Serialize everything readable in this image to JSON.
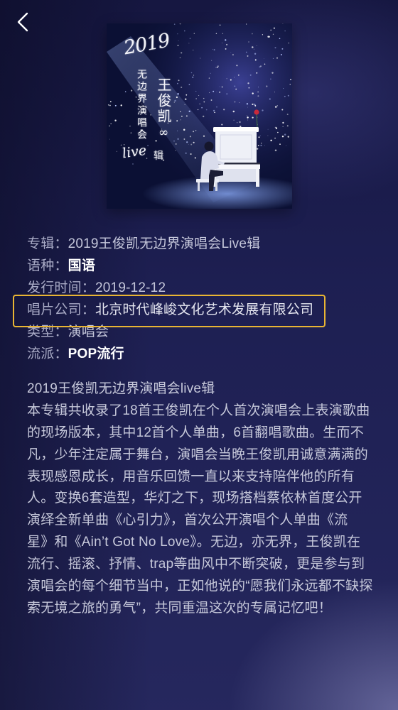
{
  "icons": {
    "back": "chevron-left-icon"
  },
  "album": {
    "cover": {
      "year": "2019",
      "subtitle": "无边界演唱会",
      "artist": "王俊凯",
      "mark": "∞",
      "live": "live",
      "suffix": "辑"
    }
  },
  "info": {
    "rows": [
      {
        "label": "专辑：",
        "value": "2019王俊凯无边界演唱会Live辑"
      },
      {
        "label": "语种：",
        "value": "国语"
      },
      {
        "label": "发行时间：",
        "value": "2019-12-12"
      },
      {
        "label": "唱片公司：",
        "value": "北京时代峰峻文化艺术发展有限公司"
      },
      {
        "label": "类型：",
        "value": "演唱会"
      },
      {
        "label": "流派：",
        "value": "POP流行"
      }
    ]
  },
  "description": {
    "title": "2019王俊凯无边界演唱会live辑",
    "lines": [
      "本专辑共收录了18首王俊凯在个人首次演唱会上表演歌曲",
      "的现场版本，其中12首个人单曲，6首翻唱歌曲。生而不",
      "凡，少年注定属于舞台，演唱会当晚王俊凯用诚意满满的",
      "表现感恩成长，用音乐回馈一直以来支持陪伴他的所有",
      "人。变换6套造型，华灯之下，现场搭档蔡依林首度公开",
      "演绎全新单曲《心引力》，首次公开演唱个人单曲《流",
      "星》和《Ain’t Got No Love》。无边，亦无界，王俊凯在",
      "流行、摇滚、抒情、trap等曲风中不断突破，更是参与到",
      "演唱会的每个细节当中，正如他说的“愿我们永远都不缺探",
      "索无境之旅的勇气”，共同重温这次的专属记忆吧！"
    ]
  },
  "theme": {
    "background": "#21235a",
    "label_color": "#a9abc6",
    "value_color": "#c4c6da",
    "bright_value_color": "#e4e5ef",
    "link_color": "#ffffff",
    "text_color": "#c6c8da",
    "highlight_border": "#e9b533"
  }
}
